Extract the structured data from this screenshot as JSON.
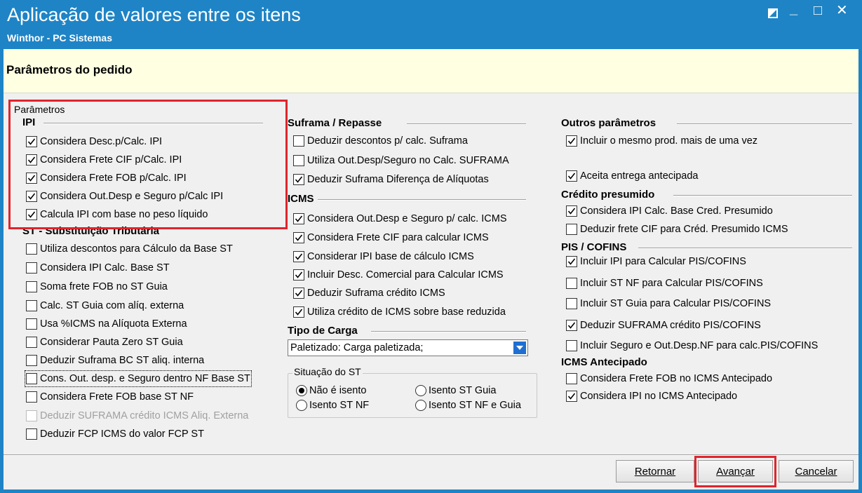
{
  "window": {
    "title": "Aplicação de valores entre os itens",
    "subtitle": "Winthor - PC Sistemas",
    "restore_icon": "restore-square-icon",
    "minimize_glyph": "_",
    "maximize_glyph": "□",
    "close_glyph": "✕"
  },
  "header": {
    "title": "Parâmetros do pedido"
  },
  "parametros_group": "Parâmetros",
  "ipi": {
    "title": "IPI",
    "items": [
      {
        "label": "Considera Desc.p/Calc. IPI",
        "checked": true
      },
      {
        "label": "Considera Frete CIF p/Calc. IPI",
        "checked": true
      },
      {
        "label": "Considera Frete FOB p/Calc. IPI",
        "checked": true
      },
      {
        "label": "Considera Out.Desp e Seguro p/Calc IPI",
        "checked": true
      },
      {
        "label": "Calcula IPI com base no peso líquido",
        "checked": true
      }
    ]
  },
  "st": {
    "title": "ST - Substituição Tributária",
    "items": [
      {
        "label": "Utiliza descontos para Cálculo da Base ST",
        "checked": false
      },
      {
        "label": "Considera IPI Calc. Base ST",
        "checked": false
      },
      {
        "label": "Soma frete FOB no ST Guia",
        "checked": false
      },
      {
        "label": "Calc. ST Guia com alíq. externa",
        "checked": false
      },
      {
        "label": "Usa %ICMS na Alíquota Externa",
        "checked": false
      },
      {
        "label": "Considerar Pauta Zero ST Guia",
        "checked": false
      },
      {
        "label": "Deduzir Suframa BC ST aliq. interna",
        "checked": false
      },
      {
        "label": "Cons. Out. desp. e Seguro dentro NF Base ST",
        "checked": false
      },
      {
        "label": "Considera Frete FOB base ST NF",
        "checked": false
      },
      {
        "label": "Deduzir SUFRAMA crédito ICMS Aliq. Externa",
        "checked": false,
        "disabled": true
      },
      {
        "label": "Deduzir FCP ICMS do valor FCP ST",
        "checked": false
      }
    ]
  },
  "suframa": {
    "title": "Suframa / Repasse",
    "items": [
      {
        "label": "Deduzir descontos p/ calc. Suframa",
        "checked": false
      },
      {
        "label": "Utiliza Out.Desp/Seguro no Calc. SUFRAMA",
        "checked": false
      },
      {
        "label": "Deduzir Suframa Diferença de Alíquotas",
        "checked": true
      }
    ]
  },
  "icms": {
    "title": "ICMS",
    "items": [
      {
        "label": "Considera Out.Desp e Seguro p/ calc. ICMS",
        "checked": true
      },
      {
        "label": "Considera Frete CIF para calcular ICMS",
        "checked": true
      },
      {
        "label": "Considerar IPI base de cálculo ICMS",
        "checked": true
      },
      {
        "label": "Incluir Desc. Comercial  para Calcular ICMS",
        "checked": true
      },
      {
        "label": "Deduzir Suframa crédito ICMS",
        "checked": true
      },
      {
        "label": "Utiliza crédito de ICMS sobre base reduzida",
        "checked": true
      }
    ]
  },
  "tipo_carga": {
    "title": "Tipo de Carga",
    "selected": "Paletizado: Carga paletizada;",
    "arrow_icon": "chevron-down-icon"
  },
  "situacao_st": {
    "title": "Situação do ST",
    "options": [
      {
        "label": "Não é isento",
        "selected": true
      },
      {
        "label": "Isento ST Guia",
        "selected": false
      },
      {
        "label": "Isento ST NF",
        "selected": false
      },
      {
        "label": "Isento ST NF e Guia",
        "selected": false
      }
    ]
  },
  "outros": {
    "title": "Outros parâmetros",
    "items": [
      {
        "label": "Incluir o mesmo prod. mais de uma vez",
        "checked": true
      },
      {
        "label": "Aceita entrega antecipada",
        "checked": true
      }
    ]
  },
  "credito": {
    "title": "Crédito presumido",
    "items": [
      {
        "label": "Considera IPI Calc. Base Cred. Presumido",
        "checked": true
      },
      {
        "label": "Deduzir frete CIF para Créd. Presumido ICMS",
        "checked": false
      }
    ]
  },
  "pis": {
    "title": "PIS / COFINS",
    "items": [
      {
        "label": "Incluir IPI para Calcular PIS/COFINS",
        "checked": true
      },
      {
        "label": "Incluir ST NF para Calcular PIS/COFINS",
        "checked": false
      },
      {
        "label": "Incluir ST Guia para Calcular PIS/COFINS",
        "checked": false
      },
      {
        "label": "Deduzir SUFRAMA crédito PIS/COFINS",
        "checked": true
      },
      {
        "label": "Incluir Seguro e Out.Desp.NF para calc.PIS/COFINS",
        "checked": false
      }
    ]
  },
  "icms_antecipado": {
    "title": "ICMS Antecipado",
    "items": [
      {
        "label": "Considera Frete FOB no ICMS Antecipado",
        "checked": false
      },
      {
        "label": "Considera IPI no ICMS Antecipado",
        "checked": true
      }
    ]
  },
  "buttons": {
    "retornar": "Retornar",
    "avancar": "Avançar",
    "cancelar": "Cancelar"
  }
}
